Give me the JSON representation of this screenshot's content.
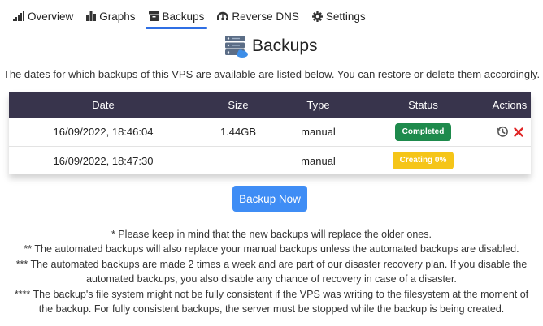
{
  "tabs": [
    {
      "label": "Overview",
      "icon": "signal-bars-icon"
    },
    {
      "label": "Graphs",
      "icon": "bar-chart-icon"
    },
    {
      "label": "Backups",
      "icon": "archive-box-icon",
      "active": true
    },
    {
      "label": "Reverse DNS",
      "icon": "network-icon"
    },
    {
      "label": "Settings",
      "icon": "gear-icon"
    }
  ],
  "page": {
    "title": "Backups",
    "description": "The dates for which backups of this VPS are available are listed below. You can restore or delete them accordingly."
  },
  "table": {
    "headers": {
      "date": "Date",
      "size": "Size",
      "type": "Type",
      "status": "Status",
      "actions": "Actions"
    },
    "rows": [
      {
        "date": "16/09/2022, 18:46:04",
        "size": "1.44GB",
        "type": "manual",
        "status": "Completed"
      },
      {
        "date": "16/09/2022, 18:47:30",
        "size": "",
        "type": "manual",
        "status": "Creating 0%"
      }
    ]
  },
  "backup_button": {
    "label": "Backup Now"
  },
  "notes": [
    "* Please keep in mind that the new backups will replace the older ones.",
    "** The automated backups will also replace your manual backups unless the automated backups are disabled.",
    "*** The automated backups are made 2 times a week and are part of our disaster recovery plan. If you disable the",
    "automated backups, you also disable any chance of recovery in case of a disaster.",
    "**** The backup's file system might not be fully consistent if the VPS was writing to the filesystem at the moment of",
    "the backup. For fully consistent backups, the server must be stopped while the backup is being created."
  ],
  "colors": {
    "tab_active_underline": "#2f6fe4",
    "table_header_bg": "#38344c",
    "status_completed": "#1e8a4c",
    "status_creating": "#f5c518",
    "delete_icon": "#e02424",
    "primary_button": "#3f8df5"
  }
}
